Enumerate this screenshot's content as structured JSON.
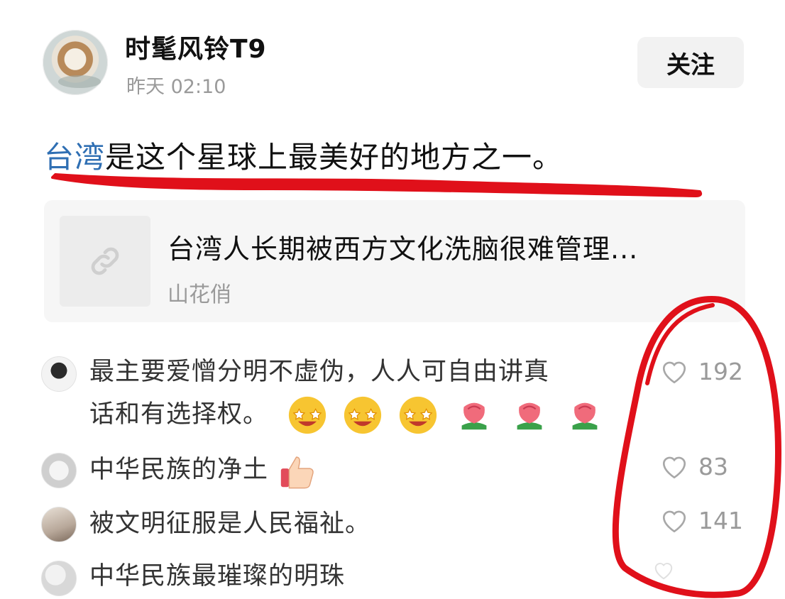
{
  "post": {
    "author": "时髦风铃T9",
    "timestamp": "昨天  02:10",
    "follow_label": "关注",
    "text_topic": "台湾",
    "text_rest": "是这个星球上最美好的地方之一。"
  },
  "link_card": {
    "title": "台湾人长期被西方文化洗脑很难管理...",
    "source": "山花俏",
    "icon": "link-icon"
  },
  "comments": [
    {
      "text": "最主要爱憎分明不虚伪，人人可自由讲真",
      "text2": "话和有选择权。",
      "likes": "192"
    },
    {
      "text": "中华民族的净土",
      "likes": "83"
    },
    {
      "text": "被文明征服是人民福祉。",
      "likes": "141"
    },
    {
      "text": "中华民族最璀璨的明珠"
    }
  ],
  "colors": {
    "topic_link": "#2f6fb3",
    "annotation_red": "#e0101a"
  }
}
